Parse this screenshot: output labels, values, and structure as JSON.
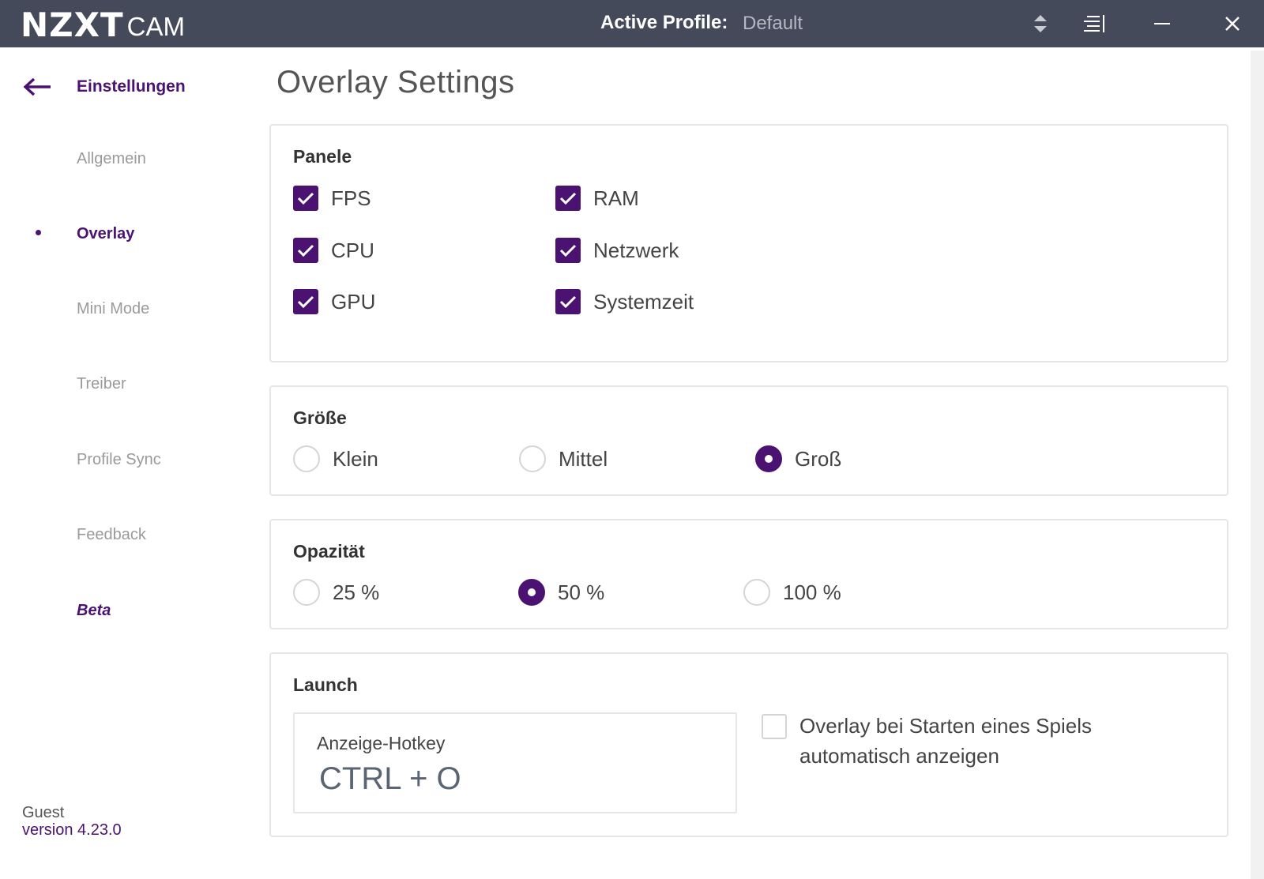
{
  "titlebar": {
    "logo_main": "NZXT",
    "logo_sub": "CAM",
    "profile_label": "Active Profile:",
    "profile_value": "Default"
  },
  "sidebar": {
    "title": "Einstellungen",
    "items": [
      {
        "label": "Allgemein"
      },
      {
        "label": "Overlay"
      },
      {
        "label": "Mini Mode"
      },
      {
        "label": "Treiber"
      },
      {
        "label": "Profile Sync"
      },
      {
        "label": "Feedback"
      },
      {
        "label": "Beta"
      }
    ],
    "active_item": "Overlay",
    "user": "Guest",
    "version": "version 4.23.0"
  },
  "main": {
    "title": "Overlay Settings",
    "panels": {
      "title": "Panele",
      "options": [
        {
          "label": "FPS",
          "checked": true
        },
        {
          "label": "CPU",
          "checked": true
        },
        {
          "label": "GPU",
          "checked": true
        },
        {
          "label": "RAM",
          "checked": true
        },
        {
          "label": "Netzwerk",
          "checked": true
        },
        {
          "label": "Systemzeit",
          "checked": true
        }
      ]
    },
    "size": {
      "title": "Größe",
      "options": [
        "Klein",
        "Mittel",
        "Groß"
      ],
      "selected": "Groß"
    },
    "opacity": {
      "title": "Opazität",
      "options": [
        "25 %",
        "50 %",
        "100 %"
      ],
      "selected": "50 %"
    },
    "launch": {
      "title": "Launch",
      "hotkey_label": "Anzeige-Hotkey",
      "hotkey_value": "CTRL + O",
      "auto_show_label": "Overlay bei Starten eines Spiels automatisch anzeigen",
      "auto_show_checked": false
    }
  },
  "colors": {
    "titlebar_bg": "#454a5a",
    "accent": "#4b1271",
    "muted_text": "#9a9a9a"
  }
}
